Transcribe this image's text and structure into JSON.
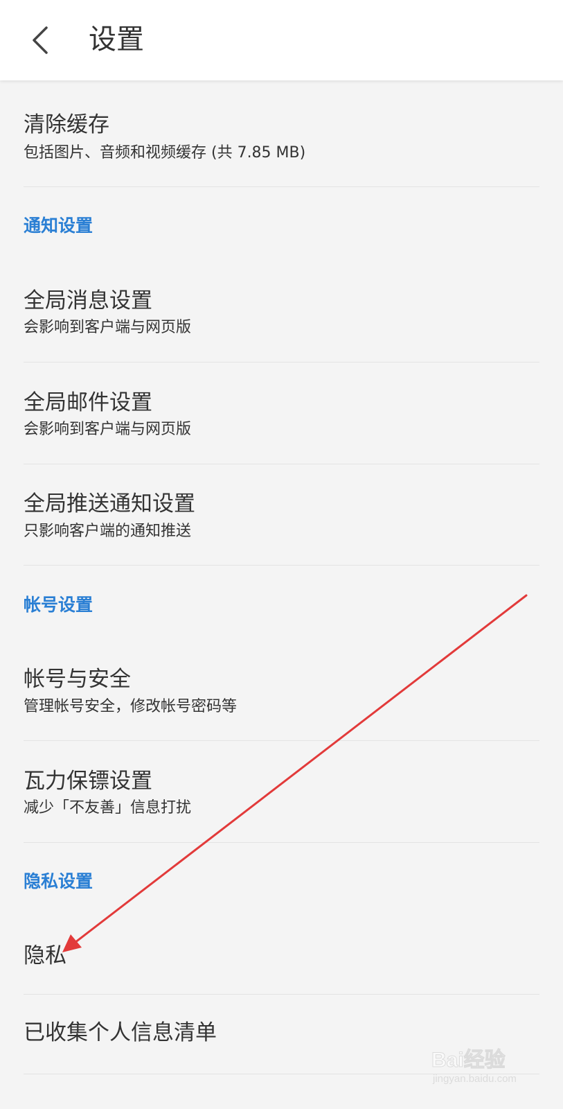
{
  "header": {
    "title": "设置"
  },
  "items": {
    "clear_cache": {
      "title": "清除缓存",
      "subtitle": "包括图片、音频和视频缓存 (共 7.85 MB)"
    },
    "global_message": {
      "title": "全局消息设置",
      "subtitle": "会影响到客户端与网页版"
    },
    "global_mail": {
      "title": "全局邮件设置",
      "subtitle": "会影响到客户端与网页版"
    },
    "global_push": {
      "title": "全局推送通知设置",
      "subtitle": "只影响客户端的通知推送"
    },
    "account_security": {
      "title": "帐号与安全",
      "subtitle": "管理帐号安全，修改帐号密码等"
    },
    "wali_guard": {
      "title": "瓦力保镖设置",
      "subtitle": "减少「不友善」信息打扰"
    },
    "privacy": {
      "title": "隐私"
    },
    "collected_info": {
      "title": "已收集个人信息清单"
    }
  },
  "sections": {
    "notification": "通知设置",
    "account": "帐号设置",
    "privacy": "隐私设置"
  },
  "watermark": {
    "brand": "Bai经验",
    "url": "jingyan.baidu.com"
  },
  "colors": {
    "background": "#f4f4f4",
    "section_header": "#2a7fd4",
    "annotation_arrow": "#e23a3a",
    "divider": "#e3e3e3"
  },
  "icons": {
    "back": "chevron-left-icon"
  }
}
